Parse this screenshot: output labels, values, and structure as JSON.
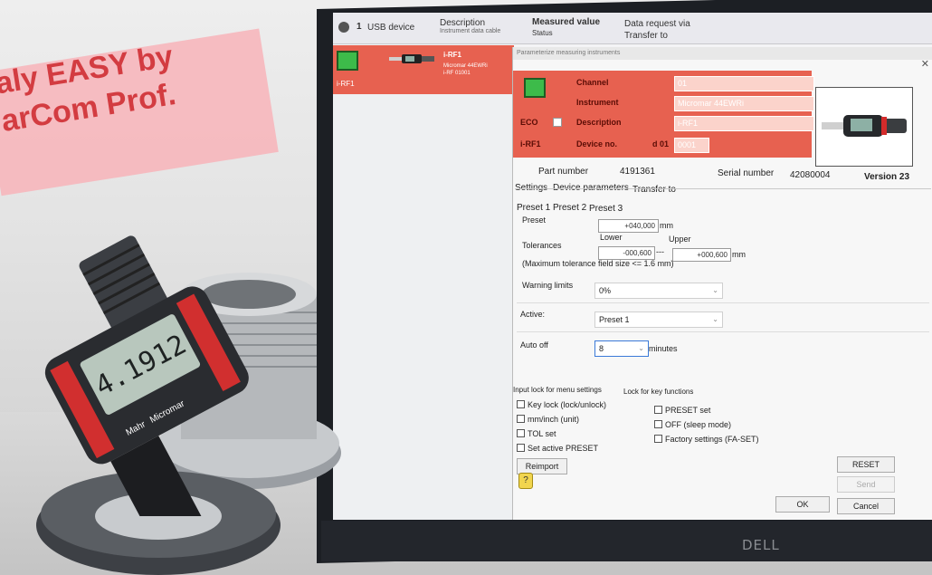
{
  "banner": {
    "line1": "aly EASY by",
    "line2": "arCom Prof."
  },
  "laptop": {
    "brand": "DELL"
  },
  "header": {
    "device_count": "1",
    "device_label": "USB device",
    "description_label": "Description",
    "description_sub": "Instrument data cable",
    "measured_value_label": "Measured value",
    "status_label": "Status",
    "data_request_label": "Data request via",
    "transfer_to_label": "Transfer to"
  },
  "device_row": {
    "name": "i-RF1",
    "title": "i-RF1",
    "line2": "Micromar 44EWRi",
    "line3": "i-RF 01001"
  },
  "dialog": {
    "title": "Parameterize measuring instruments",
    "channel_label": "Channel",
    "channel_value": "01",
    "instrument_label": "Instrument",
    "instrument_value": "Micromar 44EWRi",
    "eco_label": "ECO",
    "description_label": "Description",
    "description_value": "i-RF1",
    "irf_label": "i-RF1",
    "device_no_label": "Device no.",
    "device_no_value": "d 01",
    "device_no_field": "0001",
    "part_number_label": "Part number",
    "part_number_value": "4191361",
    "serial_number_label": "Serial number",
    "serial_number_value": "42080004",
    "version": "Version 23",
    "tabs": [
      "Settings",
      "Device parameters",
      "Transfer to"
    ],
    "preset_tabs": [
      "Preset 1",
      "Preset 2",
      "Preset 3"
    ],
    "preset_label": "Preset",
    "preset_value": "+040,000",
    "unit": "mm",
    "lower_label": "Lower",
    "upper_label": "Upper",
    "tolerances_label": "Tolerances",
    "tol_lower": "-000,600",
    "tol_sep": "---",
    "tol_upper": "+000,600",
    "max_tol_note": "(Maximum tolerance field size <= 1.6 mm)",
    "warning_limits_label": "Warning limits",
    "warning_limits_value": "0%",
    "active_label": "Active:",
    "active_value": "Preset 1",
    "auto_off_label": "Auto off",
    "auto_off_value": "8",
    "minutes_label": "minutes",
    "input_lock_label": "Input lock for menu settings",
    "key_lock_functions_label": "Lock for key functions",
    "checkboxes_left": [
      "Key lock (lock/unlock)",
      "mm/inch (unit)",
      "TOL set",
      "Set active PRESET"
    ],
    "checkboxes_right": [
      "PRESET set",
      "OFF (sleep mode)",
      "Factory settings (FA-SET)"
    ],
    "reimport_label": "Reimport",
    "reset_label": "RESET",
    "send_label": "Send",
    "ok_label": "OK",
    "cancel_label": "Cancel"
  },
  "micrometer": {
    "display_reading": "4.1912",
    "brand": "Mahr",
    "model": "Micromar"
  },
  "colors": {
    "accent_red": "#e76150",
    "banner_pink": "#f6b7bd",
    "banner_text": "#d33c41",
    "status_green": "#3dbb4a"
  }
}
